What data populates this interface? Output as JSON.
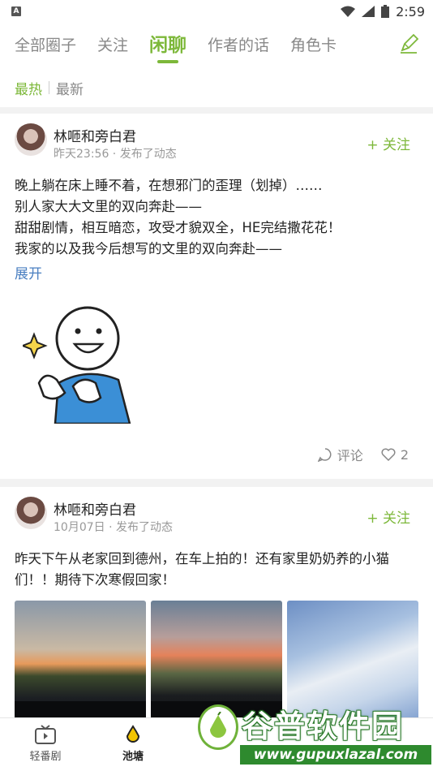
{
  "status": {
    "time": "2:59",
    "a_badge": "A"
  },
  "tabs": [
    {
      "label": "全部圈子"
    },
    {
      "label": "关注"
    },
    {
      "label": "闲聊"
    },
    {
      "label": "作者的话"
    },
    {
      "label": "角色卡"
    }
  ],
  "filter": {
    "hot": "最热",
    "new": "最新"
  },
  "posts": [
    {
      "user": "林咂和旁白君",
      "time": "昨天23:56 · 发布了动态",
      "follow": "+ 关注",
      "lines": [
        "晚上躺在床上睡不着，在想邪门的歪理（划掉）……",
        "别人家大大文里的双向奔赴——",
        "甜甜剧情，相互暗恋，攻受才貌双全，HE完结撒花花！",
        "我家的以及我今后想写的文里的双向奔赴——"
      ],
      "expand": "展开",
      "comment": "评论",
      "likes": "2"
    },
    {
      "user": "林咂和旁白君",
      "time": "10月07日 · 发布了动态",
      "follow": "+ 关注",
      "lines": [
        "昨天下午从老家回到德州，在车上拍的！还有家里奶奶养的小猫",
        "们！！期待下次寒假回家！"
      ]
    }
  ],
  "bottom_nav": [
    {
      "label": "轻番剧"
    },
    {
      "label": "池塘"
    }
  ],
  "watermark": {
    "title": "谷普软件园",
    "url": "www.gupuxlazal.com"
  },
  "colors": {
    "accent": "#7db83a",
    "link": "#4a7fc1"
  }
}
